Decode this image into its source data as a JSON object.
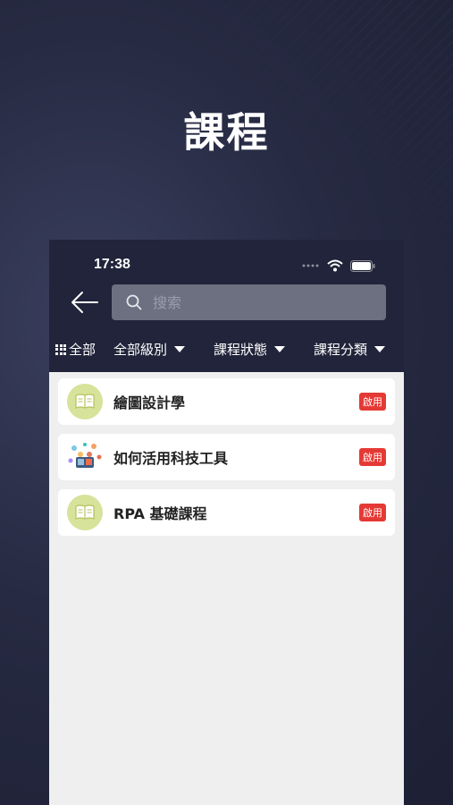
{
  "hero": {
    "title": "課程"
  },
  "status_bar": {
    "time": "17:38"
  },
  "search": {
    "placeholder": "搜索",
    "value": ""
  },
  "filters": {
    "all_label": "全部",
    "level_label": "全部級別",
    "status_label": "課程狀態",
    "category_label": "課程分類"
  },
  "courses": [
    {
      "title": "繪圖設計學",
      "badge": "啟用",
      "icon": "book-icon"
    },
    {
      "title": "如何活用科技工具",
      "badge": "啟用",
      "icon": "people-tech-illustration-icon"
    },
    {
      "title": "RPA 基礎課程",
      "badge": "啟用",
      "icon": "book-icon"
    }
  ],
  "colors": {
    "header_bg": "#21243a",
    "search_bg": "#6d7080",
    "icon_circle": "#d7e29a",
    "badge_red": "#e53935",
    "list_bg": "#efefef"
  }
}
